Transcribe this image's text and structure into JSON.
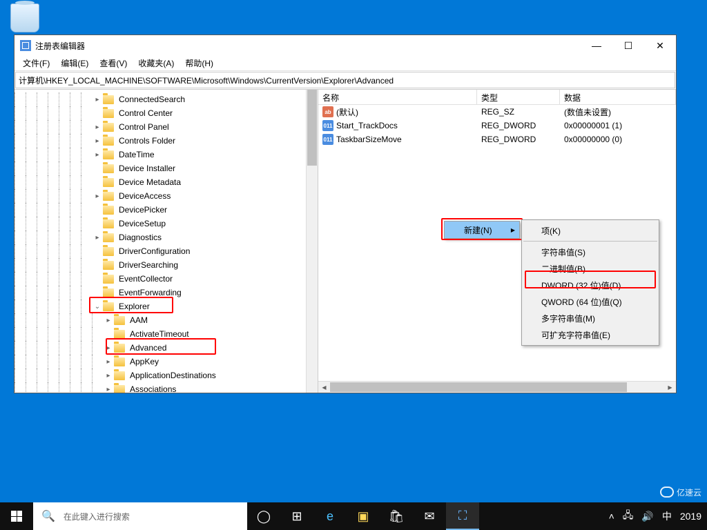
{
  "window": {
    "title": "注册表编辑器",
    "minimize": "—",
    "maximize": "☐",
    "close": "✕"
  },
  "menu": {
    "file": "文件(F)",
    "edit": "编辑(E)",
    "view": "查看(V)",
    "favorites": "收藏夹(A)",
    "help": "帮助(H)"
  },
  "address": "计算机\\HKEY_LOCAL_MACHINE\\SOFTWARE\\Microsoft\\Windows\\CurrentVersion\\Explorer\\Advanced",
  "tree": [
    {
      "label": "ConnectedSearch",
      "exp": "▸",
      "depth": 7
    },
    {
      "label": "Control Center",
      "exp": "",
      "depth": 7
    },
    {
      "label": "Control Panel",
      "exp": "▸",
      "depth": 7
    },
    {
      "label": "Controls Folder",
      "exp": "▸",
      "depth": 7
    },
    {
      "label": "DateTime",
      "exp": "▸",
      "depth": 7
    },
    {
      "label": "Device Installer",
      "exp": "",
      "depth": 7
    },
    {
      "label": "Device Metadata",
      "exp": "",
      "depth": 7
    },
    {
      "label": "DeviceAccess",
      "exp": "▸",
      "depth": 7
    },
    {
      "label": "DevicePicker",
      "exp": "",
      "depth": 7
    },
    {
      "label": "DeviceSetup",
      "exp": "",
      "depth": 7
    },
    {
      "label": "Diagnostics",
      "exp": "▸",
      "depth": 7
    },
    {
      "label": "DriverConfiguration",
      "exp": "",
      "depth": 7
    },
    {
      "label": "DriverSearching",
      "exp": "",
      "depth": 7
    },
    {
      "label": "EventCollector",
      "exp": "",
      "depth": 7
    },
    {
      "label": "EventForwarding",
      "exp": "",
      "depth": 7
    },
    {
      "label": "Explorer",
      "exp": "⌄",
      "depth": 7
    },
    {
      "label": "AAM",
      "exp": "▸",
      "depth": 8
    },
    {
      "label": "ActivateTimeout",
      "exp": "",
      "depth": 8
    },
    {
      "label": "Advanced",
      "exp": "▸",
      "depth": 8
    },
    {
      "label": "AppKey",
      "exp": "▸",
      "depth": 8
    },
    {
      "label": "ApplicationDestinations",
      "exp": "▸",
      "depth": 8
    },
    {
      "label": "Associations",
      "exp": "▸",
      "depth": 8
    }
  ],
  "list": {
    "cols": {
      "name": "名称",
      "type": "类型",
      "data": "数据"
    },
    "rows": [
      {
        "icon": "sz",
        "iconTxt": "ab",
        "name": "(默认)",
        "type": "REG_SZ",
        "data": "(数值未设置)"
      },
      {
        "icon": "dw",
        "iconTxt": "011",
        "name": "Start_TrackDocs",
        "type": "REG_DWORD",
        "data": "0x00000001 (1)"
      },
      {
        "icon": "dw",
        "iconTxt": "011",
        "name": "TaskbarSizeMove",
        "type": "REG_DWORD",
        "data": "0x00000000 (0)"
      }
    ]
  },
  "ctx1": {
    "new": "新建(N)"
  },
  "ctx2": {
    "key": "项(K)",
    "string": "字符串值(S)",
    "binary": "二进制值(B)",
    "dword": "DWORD (32 位)值(D)",
    "qword": "QWORD (64 位)值(Q)",
    "multi": "多字符串值(M)",
    "expand": "可扩充字符串值(E)"
  },
  "taskbar": {
    "search_placeholder": "在此键入进行搜索",
    "ime": "中",
    "time": "2019"
  },
  "watermark": "亿速云"
}
